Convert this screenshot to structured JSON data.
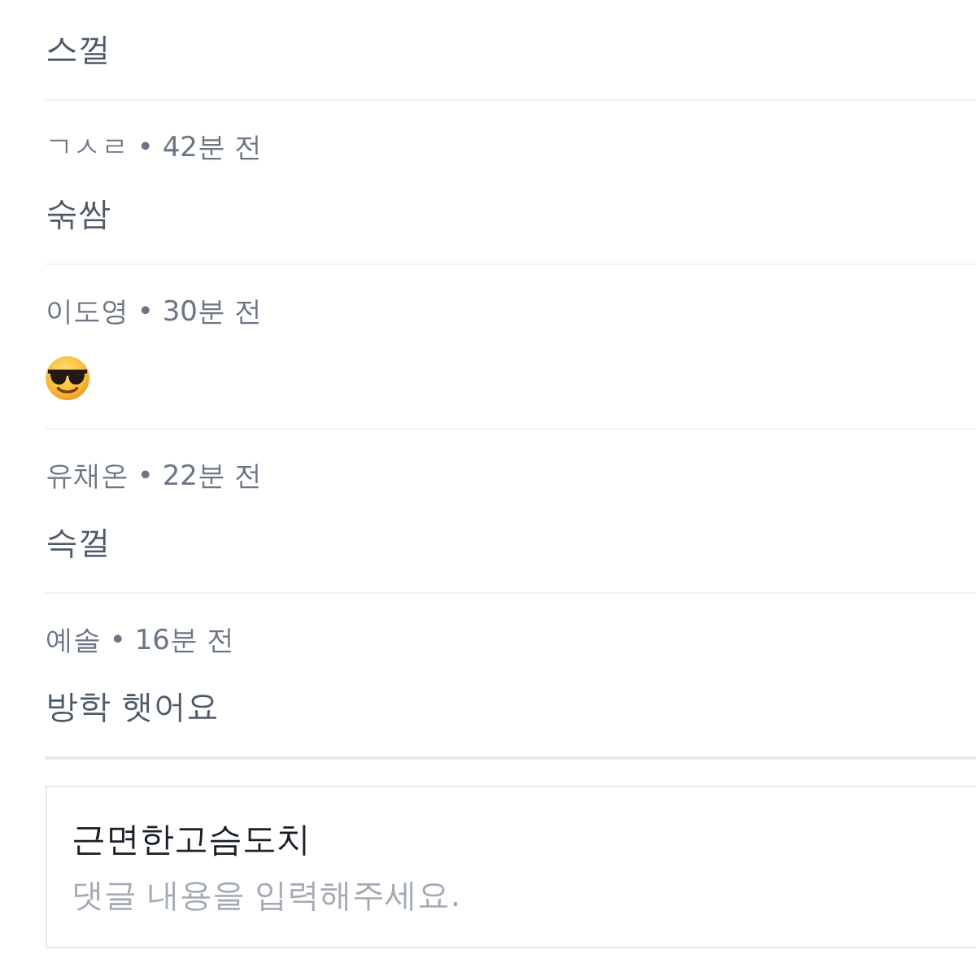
{
  "comments": [
    {
      "body": {
        "kind": "text",
        "text": "스껄"
      }
    },
    {
      "byline": "ㄱㅅㄹ • 42분 전",
      "body": {
        "kind": "text",
        "text": "숚쌈"
      }
    },
    {
      "byline": "이도영 • 30분 전",
      "body": {
        "kind": "emoji"
      }
    },
    {
      "byline": "유채온 • 22분 전",
      "body": {
        "kind": "text",
        "text": "슥껄"
      }
    },
    {
      "byline": "예솔 • 16분 전",
      "body": {
        "kind": "text",
        "text": "방학 햇어요"
      }
    }
  ],
  "comment_form": {
    "author": "근면한고슴도치",
    "placeholder": "댓글 내용을 입력해주세요."
  }
}
